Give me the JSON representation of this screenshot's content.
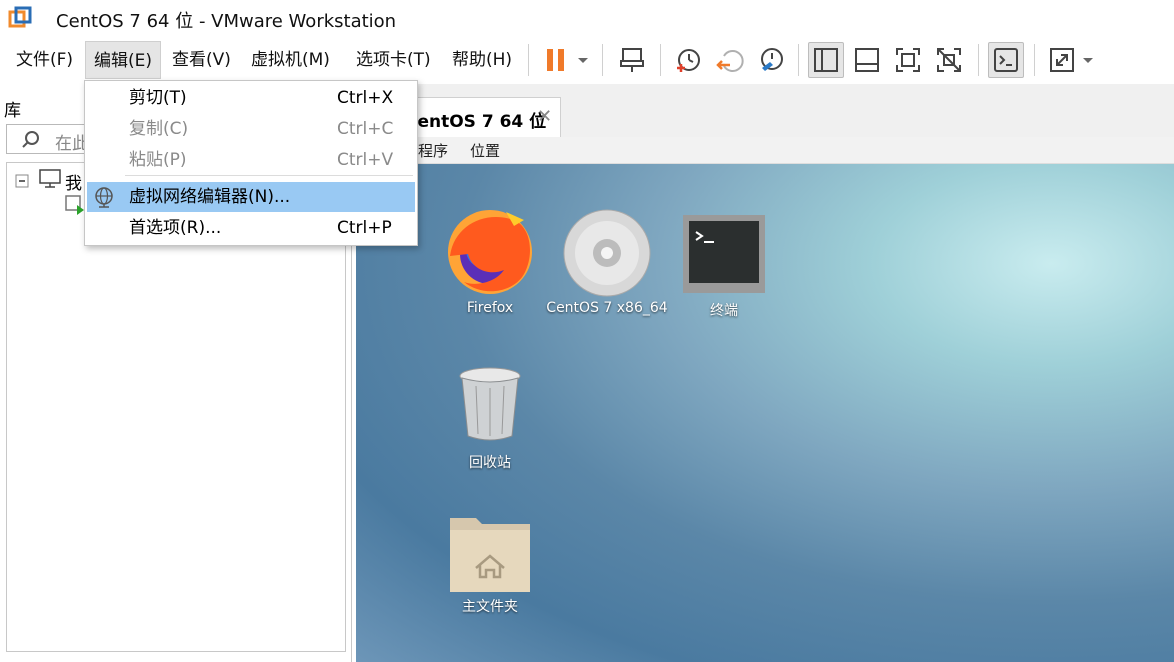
{
  "window": {
    "title": "CentOS 7 64 位 - VMware Workstation"
  },
  "menubar": {
    "items": [
      {
        "label": "文件(F)"
      },
      {
        "label": "编辑(E)"
      },
      {
        "label": "查看(V)"
      },
      {
        "label": "虚拟机(M)"
      },
      {
        "label": "选项卡(T)"
      },
      {
        "label": "帮助(H)"
      }
    ]
  },
  "edit_menu": {
    "items": [
      {
        "label": "剪切(T)",
        "shortcut": "Ctrl+X"
      },
      {
        "label": "复制(C)",
        "shortcut": "Ctrl+C"
      },
      {
        "label": "粘贴(P)",
        "shortcut": "Ctrl+V"
      },
      {
        "label": "虚拟网络编辑器(N)...",
        "shortcut": ""
      },
      {
        "label": "首选项(R)...",
        "shortcut": "Ctrl+P"
      }
    ]
  },
  "library": {
    "title": "库",
    "search_placeholder": "在此",
    "tree_root": "我"
  },
  "vm_tab": {
    "label": "CentOS 7 64 位"
  },
  "guest": {
    "menus": [
      "程序",
      "位置"
    ],
    "desktop_icons": [
      {
        "label": "Firefox"
      },
      {
        "label": "CentOS 7 x86_64"
      },
      {
        "label": "终端"
      },
      {
        "label": "回收站"
      },
      {
        "label": "主文件夹"
      }
    ]
  },
  "colors": {
    "pause_orange": "#f07a2a",
    "menu_highlight": "#99c9f3",
    "vmware_logo": "#f08a2c"
  }
}
